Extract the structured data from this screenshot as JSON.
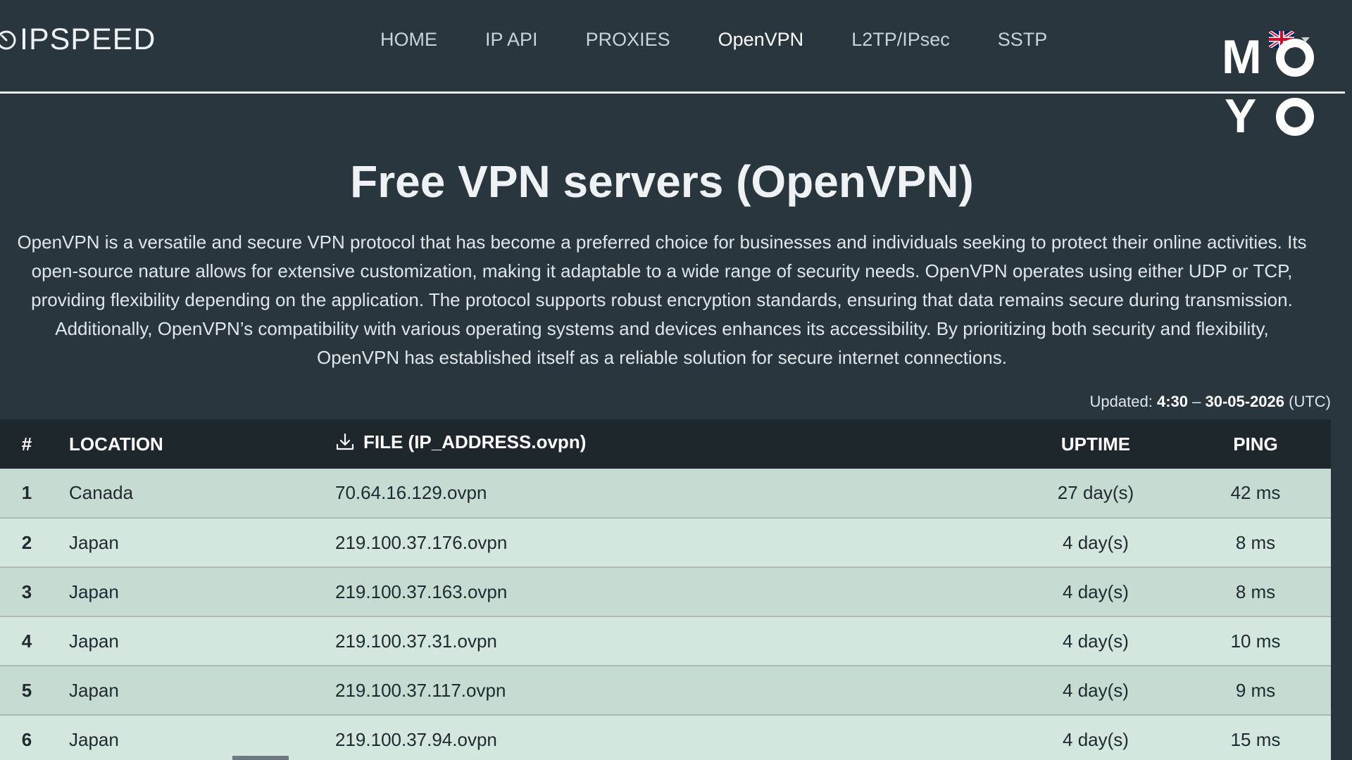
{
  "header": {
    "logo_text": "IPSPEED",
    "nav": [
      {
        "label": "HOME",
        "active": false
      },
      {
        "label": "IP API",
        "active": false
      },
      {
        "label": "PROXIES",
        "active": false
      },
      {
        "label": "OpenVPN",
        "active": true
      },
      {
        "label": "L2TP/IPsec",
        "active": false
      },
      {
        "label": "SSTP",
        "active": false
      }
    ],
    "language_icon": "uk-flag-icon"
  },
  "watermark": {
    "line1": "MO",
    "line2": "YO"
  },
  "main": {
    "title": "Free VPN servers (OpenVPN)",
    "intro_lines": [
      "OpenVPN is a versatile and secure VPN protocol that has become a preferred choice for businesses and individuals seeking to protect their online activities. Its",
      "open-source nature allows for extensive customization, making it adaptable to a wide range of security needs. OpenVPN operates using either UDP or TCP,",
      "providing flexibility depending on the application. The protocol supports robust encryption standards, ensuring that data remains secure during transmission.",
      "Additionally, OpenVPN’s compatibility with various operating systems and devices enhances its accessibility. By prioritizing both security and flexibility,",
      "OpenVPN has established itself as a reliable solution for secure internet connections."
    ],
    "updated": {
      "label": "Updated: ",
      "time": "4:30",
      "separator": " – ",
      "date": "30-05-2026",
      "zone": " (UTC)"
    }
  },
  "table": {
    "headers": {
      "num": "#",
      "location": "LOCATION",
      "file": "FILE (IP_ADDRESS.ovpn)",
      "uptime": "UPTIME",
      "ping": "PING"
    },
    "rows": [
      {
        "num": "1",
        "location": "Canada",
        "file": "70.64.16.129.ovpn",
        "uptime": "27 day(s)",
        "ping": "42 ms"
      },
      {
        "num": "2",
        "location": "Japan",
        "file": "219.100.37.176.ovpn",
        "uptime": "4 day(s)",
        "ping": "8 ms"
      },
      {
        "num": "3",
        "location": "Japan",
        "file": "219.100.37.163.ovpn",
        "uptime": "4 day(s)",
        "ping": "8 ms"
      },
      {
        "num": "4",
        "location": "Japan",
        "file": "219.100.37.31.ovpn",
        "uptime": "4 day(s)",
        "ping": "10 ms"
      },
      {
        "num": "5",
        "location": "Japan",
        "file": "219.100.37.117.ovpn",
        "uptime": "4 day(s)",
        "ping": "9 ms"
      },
      {
        "num": "6",
        "location": "Japan",
        "file": "219.100.37.94.ovpn",
        "uptime": "4 day(s)",
        "ping": "15 ms"
      }
    ]
  },
  "colors": {
    "background": "#2a363d",
    "table_header": "#1e272c",
    "row_odd": "#c6dbd2",
    "row_even": "#d3e7de"
  }
}
